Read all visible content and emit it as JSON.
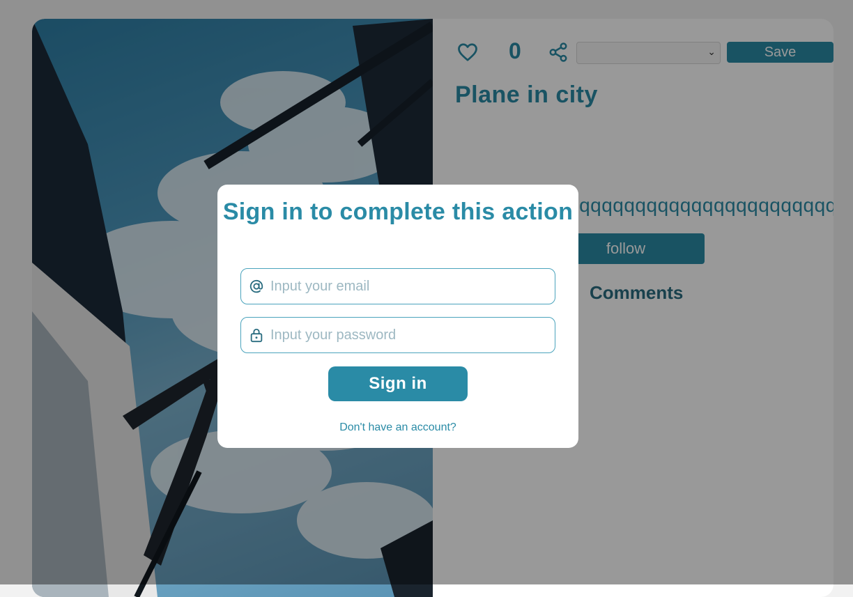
{
  "pin": {
    "like_count": "0",
    "board_select_value": "",
    "save_label": "Save",
    "title": "Plane in city",
    "description": "qqqqqqqqqqqqqqqqqqqqqqqqqqqqqq",
    "follow_label": "follow",
    "comments_heading": "Comments"
  },
  "modal": {
    "title": "Sign in to complete this action",
    "email_placeholder": "Input your email",
    "password_placeholder": "Input your password",
    "signin_label": "Sign in",
    "register_link": "Don't have an account?"
  },
  "icons": [
    "heart-icon",
    "share-icon",
    "at-sign-icon",
    "lock-icon",
    "chevron-down-icon"
  ],
  "colors": {
    "accent": "#2a8ba6",
    "overlay": "rgba(0,0,0,0.4)",
    "background": "#f2f2f2"
  }
}
